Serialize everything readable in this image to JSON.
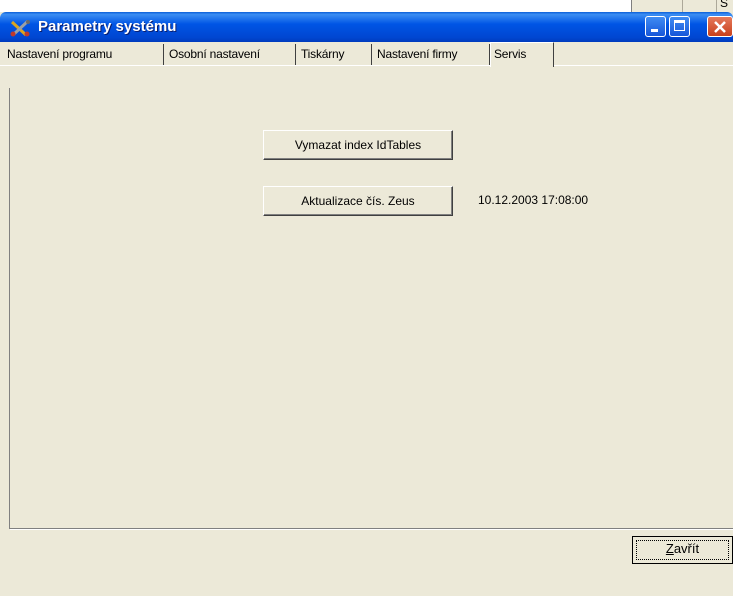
{
  "background_window": {
    "partial_text": "S"
  },
  "window": {
    "title": "Parametry systému",
    "icon": "tools-icon"
  },
  "tabs": [
    {
      "label": "Nastavení programu",
      "active": false
    },
    {
      "label": "Osobní nastavení",
      "active": false
    },
    {
      "label": "Tiskárny",
      "active": false
    },
    {
      "label": "Nastavení firmy",
      "active": false
    },
    {
      "label": "Servis",
      "active": true
    }
  ],
  "servis": {
    "clear_index_button": "Vymazat index IdTables",
    "update_button": "Aktualizace čís. Zeus",
    "update_timestamp": "10.12.2003 17:08:00"
  },
  "footer": {
    "close_button": "Zavřít",
    "close_mnemonic": "Z"
  },
  "colors": {
    "titlebar": "#0055e5",
    "dialog_bg": "#ece9d8",
    "close_btn": "#c9401c"
  }
}
